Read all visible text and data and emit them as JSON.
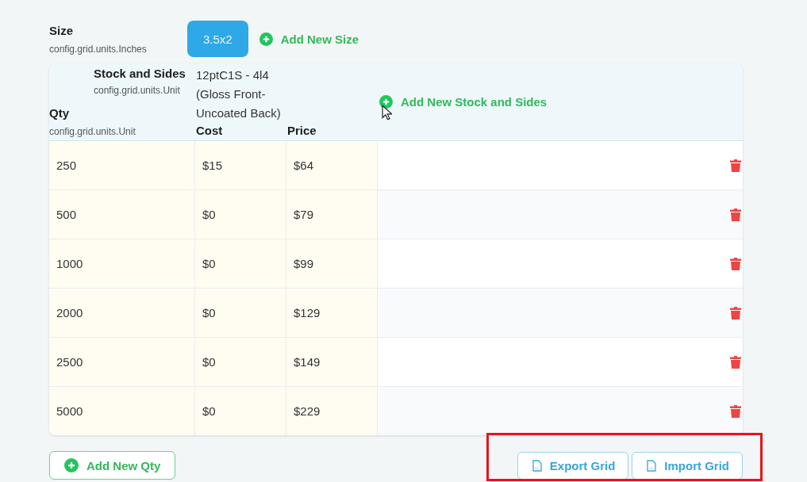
{
  "size": {
    "label": "Size",
    "units": "config.grid.units.Inches",
    "options": [
      {
        "label": "3.5x2",
        "selected": true
      }
    ],
    "add_button": "Add New Size"
  },
  "grid": {
    "stock_label": "Stock and Sides",
    "stock_units": "config.grid.units.Unit",
    "stock_options": [
      {
        "label": "12ptC1S - 4l4 (Gloss Front-Uncoated Back)"
      }
    ],
    "add_stock_button": "Add New Stock and Sides",
    "qty_label": "Qty",
    "qty_units": "config.grid.units.Unit",
    "columns": [
      "Cost",
      "Price"
    ],
    "rows": [
      {
        "qty": "250",
        "cost": "$15",
        "price": "$64"
      },
      {
        "qty": "500",
        "cost": "$0",
        "price": "$79"
      },
      {
        "qty": "1000",
        "cost": "$0",
        "price": "$99"
      },
      {
        "qty": "2000",
        "cost": "$0",
        "price": "$129"
      },
      {
        "qty": "2500",
        "cost": "$0",
        "price": "$149"
      },
      {
        "qty": "5000",
        "cost": "$0",
        "price": "$229"
      }
    ]
  },
  "footer": {
    "add_qty_button": "Add New Qty",
    "export_button": "Export Grid",
    "import_button": "Import Grid"
  }
}
